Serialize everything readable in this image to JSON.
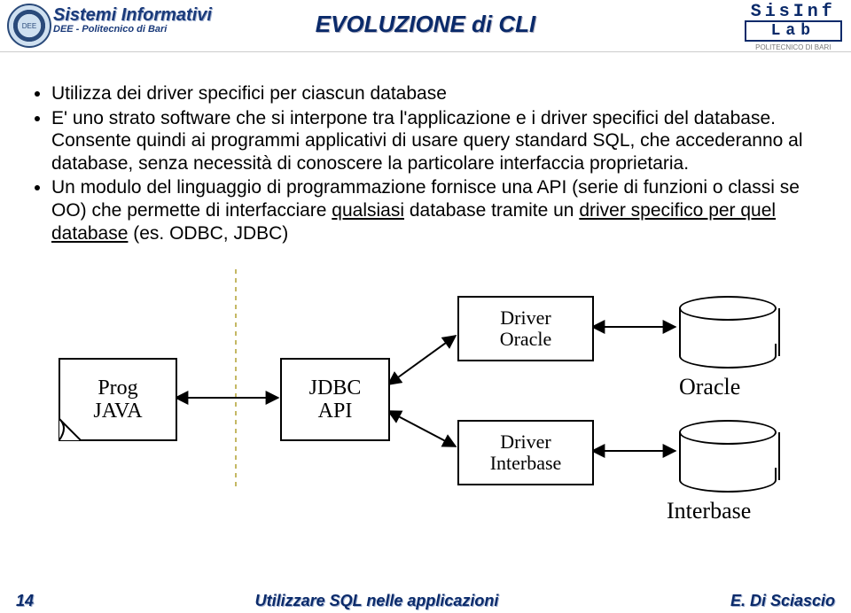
{
  "header": {
    "left_title": "Sistemi Informativi",
    "left_sub": "DEE - Politecnico di Bari",
    "center": "EVOLUZIONE di CLI",
    "right_top": "SisInf",
    "right_lab": "Lab",
    "right_sub": "POLITECNICO DI BARI"
  },
  "bullets": {
    "b1": "Utilizza dei driver specifici per ciascun database",
    "b2": "E' uno strato software che si interpone tra l'applicazione e i driver specifici del database. Consente quindi ai programmi applicativi di usare query standard SQL, che accederanno al database, senza necessità di conoscere la particolare interfaccia proprietaria.",
    "b3_pre": "Un modulo del linguaggio di programmazione fornisce una API (serie di funzioni o classi se OO)  che permette di interfacciare ",
    "b3_u1": "qualsiasi",
    "b3_mid": " database tramite un ",
    "b3_u2": "driver specifico per quel database",
    "b3_post": " (es. ODBC, JDBC)"
  },
  "diagram": {
    "prog1": "Prog",
    "prog2": "JAVA",
    "jdbc1": "JDBC",
    "jdbc2": "API",
    "driver_oracle1": "Driver",
    "driver_oracle2": "Oracle",
    "driver_interbase1": "Driver",
    "driver_interbase2": "Interbase",
    "db_oracle": "Oracle",
    "db_interbase": "Interbase"
  },
  "footer": {
    "page": "14",
    "title": "Utilizzare SQL nelle applicazioni",
    "author": "E. Di Sciascio"
  }
}
